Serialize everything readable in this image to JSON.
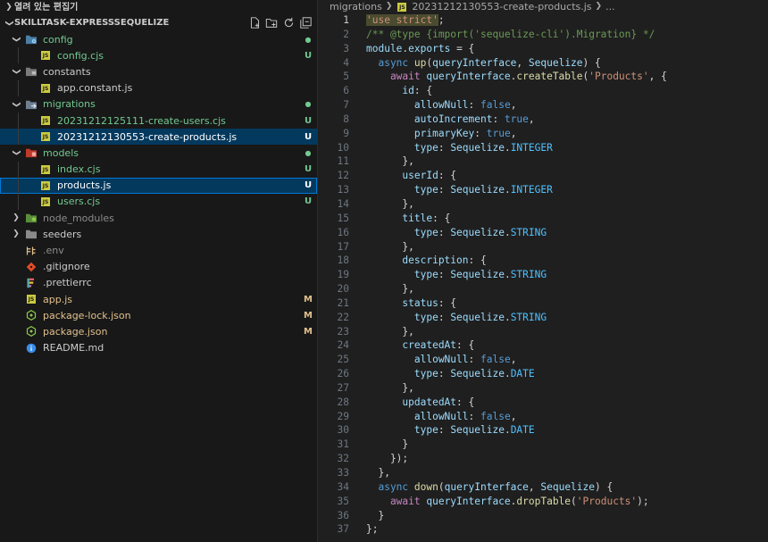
{
  "sidebar": {
    "open_editors": "열려 있는 편집기",
    "root": "SKILLTASK-EXPRESSSEQUELIZE",
    "items": [
      {
        "label": "config",
        "type": "folder",
        "depth": 0,
        "icon": "config-folder-icon",
        "open": true,
        "badge": "●",
        "badge_class": "dot",
        "color": "#73c991"
      },
      {
        "label": "config.cjs",
        "type": "file",
        "depth": 1,
        "icon": "js-file-icon",
        "badge": "U",
        "badge_class": "U",
        "color": "#73c991"
      },
      {
        "label": "constants",
        "type": "folder",
        "depth": 0,
        "icon": "constants-folder-icon",
        "open": true,
        "badge": "",
        "badge_class": "",
        "color": "#cccccc"
      },
      {
        "label": "app.constant.js",
        "type": "file",
        "depth": 1,
        "icon": "js-file-icon",
        "badge": "",
        "badge_class": "",
        "color": "#cccccc"
      },
      {
        "label": "migrations",
        "type": "folder",
        "depth": 0,
        "icon": "migrations-folder-icon",
        "open": true,
        "badge": "●",
        "badge_class": "dot",
        "color": "#73c991"
      },
      {
        "label": "20231212125111-create-users.cjs",
        "type": "file",
        "depth": 1,
        "icon": "js-file-icon",
        "badge": "U",
        "badge_class": "U",
        "color": "#73c991"
      },
      {
        "label": "20231212130553-create-products.js",
        "type": "file",
        "depth": 1,
        "icon": "js-file-icon",
        "badge": "U",
        "badge_class": "U",
        "color": "#ffffff",
        "selected": true
      },
      {
        "label": "models",
        "type": "folder",
        "depth": 0,
        "icon": "models-folder-icon",
        "open": true,
        "badge": "●",
        "badge_class": "dot",
        "color": "#73c991"
      },
      {
        "label": "index.cjs",
        "type": "file",
        "depth": 1,
        "icon": "js-file-icon",
        "badge": "U",
        "badge_class": "U",
        "color": "#73c991"
      },
      {
        "label": "products.js",
        "type": "file",
        "depth": 1,
        "icon": "js-file-icon",
        "badge": "U",
        "badge_class": "U",
        "color": "#ffffff",
        "focused": true
      },
      {
        "label": "users.cjs",
        "type": "file",
        "depth": 1,
        "icon": "js-file-icon",
        "badge": "U",
        "badge_class": "U",
        "color": "#73c991"
      },
      {
        "label": "node_modules",
        "type": "folder",
        "depth": 0,
        "icon": "node-modules-folder-icon",
        "open": false,
        "badge": "",
        "badge_class": "",
        "color": "#8c8c8c"
      },
      {
        "label": "seeders",
        "type": "folder",
        "depth": 0,
        "icon": "folder-icon",
        "open": false,
        "badge": "",
        "badge_class": "",
        "color": "#cccccc"
      },
      {
        "label": ".env",
        "type": "file",
        "depth": 0,
        "icon": "env-file-icon",
        "badge": "",
        "badge_class": "",
        "color": "#8c8c8c"
      },
      {
        "label": ".gitignore",
        "type": "file",
        "depth": 0,
        "icon": "git-file-icon",
        "badge": "",
        "badge_class": "",
        "color": "#cccccc"
      },
      {
        "label": ".prettierrc",
        "type": "file",
        "depth": 0,
        "icon": "prettier-file-icon",
        "badge": "",
        "badge_class": "",
        "color": "#cccccc"
      },
      {
        "label": "app.js",
        "type": "file",
        "depth": 0,
        "icon": "js-file-icon",
        "badge": "M",
        "badge_class": "M",
        "color": "#e2c08d"
      },
      {
        "label": "package-lock.json",
        "type": "file",
        "depth": 0,
        "icon": "npm-json-icon",
        "badge": "M",
        "badge_class": "M",
        "color": "#e2c08d"
      },
      {
        "label": "package.json",
        "type": "file",
        "depth": 0,
        "icon": "npm-json-icon",
        "badge": "M",
        "badge_class": "M",
        "color": "#e2c08d"
      },
      {
        "label": "README.md",
        "type": "file",
        "depth": 0,
        "icon": "info-icon",
        "badge": "",
        "badge_class": "",
        "color": "#cccccc"
      }
    ]
  },
  "editor": {
    "breadcrumb": [
      "migrations",
      "20231212130553-create-products.js",
      "..."
    ],
    "current_line": 1,
    "lines": [
      [
        [
          "'use strict'",
          "#ce9178"
        ],
        [
          ";",
          "#d4d4d4"
        ]
      ],
      [
        [
          "/** @type {import('sequelize-cli').Migration} */",
          "#6a9955"
        ]
      ],
      [
        [
          "module",
          "#9cdcfe"
        ],
        [
          ".",
          "#d4d4d4"
        ],
        [
          "exports",
          "#9cdcfe"
        ],
        [
          " = {",
          "#d4d4d4"
        ]
      ],
      [
        [
          "  async ",
          "#569cd6"
        ],
        [
          "up",
          "#dcdcaa"
        ],
        [
          "(",
          "#d4d4d4"
        ],
        [
          "queryInterface",
          "#9cdcfe"
        ],
        [
          ", ",
          "#d4d4d4"
        ],
        [
          "Sequelize",
          "#9cdcfe"
        ],
        [
          ") {",
          "#d4d4d4"
        ]
      ],
      [
        [
          "    await ",
          "#c586c0"
        ],
        [
          "queryInterface",
          "#9cdcfe"
        ],
        [
          ".",
          "#d4d4d4"
        ],
        [
          "createTable",
          "#dcdcaa"
        ],
        [
          "(",
          "#d4d4d4"
        ],
        [
          "'Products'",
          "#ce9178"
        ],
        [
          ", {",
          "#d4d4d4"
        ]
      ],
      [
        [
          "      id",
          "#9cdcfe"
        ],
        [
          ": {",
          "#d4d4d4"
        ]
      ],
      [
        [
          "        allowNull",
          "#9cdcfe"
        ],
        [
          ": ",
          "#d4d4d4"
        ],
        [
          "false",
          "#569cd6"
        ],
        [
          ",",
          "#d4d4d4"
        ]
      ],
      [
        [
          "        autoIncrement",
          "#9cdcfe"
        ],
        [
          ": ",
          "#d4d4d4"
        ],
        [
          "true",
          "#569cd6"
        ],
        [
          ",",
          "#d4d4d4"
        ]
      ],
      [
        [
          "        primaryKey",
          "#9cdcfe"
        ],
        [
          ": ",
          "#d4d4d4"
        ],
        [
          "true",
          "#569cd6"
        ],
        [
          ",",
          "#d4d4d4"
        ]
      ],
      [
        [
          "        type",
          "#9cdcfe"
        ],
        [
          ": ",
          "#d4d4d4"
        ],
        [
          "Sequelize",
          "#9cdcfe"
        ],
        [
          ".",
          "#d4d4d4"
        ],
        [
          "INTEGER",
          "#4fc1ff"
        ]
      ],
      [
        [
          "      },",
          "#d4d4d4"
        ]
      ],
      [
        [
          "      userId",
          "#9cdcfe"
        ],
        [
          ": {",
          "#d4d4d4"
        ]
      ],
      [
        [
          "        type",
          "#9cdcfe"
        ],
        [
          ": ",
          "#d4d4d4"
        ],
        [
          "Sequelize",
          "#9cdcfe"
        ],
        [
          ".",
          "#d4d4d4"
        ],
        [
          "INTEGER",
          "#4fc1ff"
        ]
      ],
      [
        [
          "      },",
          "#d4d4d4"
        ]
      ],
      [
        [
          "      title",
          "#9cdcfe"
        ],
        [
          ": {",
          "#d4d4d4"
        ]
      ],
      [
        [
          "        type",
          "#9cdcfe"
        ],
        [
          ": ",
          "#d4d4d4"
        ],
        [
          "Sequelize",
          "#9cdcfe"
        ],
        [
          ".",
          "#d4d4d4"
        ],
        [
          "STRING",
          "#4fc1ff"
        ]
      ],
      [
        [
          "      },",
          "#d4d4d4"
        ]
      ],
      [
        [
          "      description",
          "#9cdcfe"
        ],
        [
          ": {",
          "#d4d4d4"
        ]
      ],
      [
        [
          "        type",
          "#9cdcfe"
        ],
        [
          ": ",
          "#d4d4d4"
        ],
        [
          "Sequelize",
          "#9cdcfe"
        ],
        [
          ".",
          "#d4d4d4"
        ],
        [
          "STRING",
          "#4fc1ff"
        ]
      ],
      [
        [
          "      },",
          "#d4d4d4"
        ]
      ],
      [
        [
          "      status",
          "#9cdcfe"
        ],
        [
          ": {",
          "#d4d4d4"
        ]
      ],
      [
        [
          "        type",
          "#9cdcfe"
        ],
        [
          ": ",
          "#d4d4d4"
        ],
        [
          "Sequelize",
          "#9cdcfe"
        ],
        [
          ".",
          "#d4d4d4"
        ],
        [
          "STRING",
          "#4fc1ff"
        ]
      ],
      [
        [
          "      },",
          "#d4d4d4"
        ]
      ],
      [
        [
          "      createdAt",
          "#9cdcfe"
        ],
        [
          ": {",
          "#d4d4d4"
        ]
      ],
      [
        [
          "        allowNull",
          "#9cdcfe"
        ],
        [
          ": ",
          "#d4d4d4"
        ],
        [
          "false",
          "#569cd6"
        ],
        [
          ",",
          "#d4d4d4"
        ]
      ],
      [
        [
          "        type",
          "#9cdcfe"
        ],
        [
          ": ",
          "#d4d4d4"
        ],
        [
          "Sequelize",
          "#9cdcfe"
        ],
        [
          ".",
          "#d4d4d4"
        ],
        [
          "DATE",
          "#4fc1ff"
        ]
      ],
      [
        [
          "      },",
          "#d4d4d4"
        ]
      ],
      [
        [
          "      updatedAt",
          "#9cdcfe"
        ],
        [
          ": {",
          "#d4d4d4"
        ]
      ],
      [
        [
          "        allowNull",
          "#9cdcfe"
        ],
        [
          ": ",
          "#d4d4d4"
        ],
        [
          "false",
          "#569cd6"
        ],
        [
          ",",
          "#d4d4d4"
        ]
      ],
      [
        [
          "        type",
          "#9cdcfe"
        ],
        [
          ": ",
          "#d4d4d4"
        ],
        [
          "Sequelize",
          "#9cdcfe"
        ],
        [
          ".",
          "#d4d4d4"
        ],
        [
          "DATE",
          "#4fc1ff"
        ]
      ],
      [
        [
          "      }",
          "#d4d4d4"
        ]
      ],
      [
        [
          "    });",
          "#d4d4d4"
        ]
      ],
      [
        [
          "  },",
          "#d4d4d4"
        ]
      ],
      [
        [
          "  async ",
          "#569cd6"
        ],
        [
          "down",
          "#dcdcaa"
        ],
        [
          "(",
          "#d4d4d4"
        ],
        [
          "queryInterface",
          "#9cdcfe"
        ],
        [
          ", ",
          "#d4d4d4"
        ],
        [
          "Sequelize",
          "#9cdcfe"
        ],
        [
          ") {",
          "#d4d4d4"
        ]
      ],
      [
        [
          "    await ",
          "#c586c0"
        ],
        [
          "queryInterface",
          "#9cdcfe"
        ],
        [
          ".",
          "#d4d4d4"
        ],
        [
          "dropTable",
          "#dcdcaa"
        ],
        [
          "(",
          "#d4d4d4"
        ],
        [
          "'Products'",
          "#ce9178"
        ],
        [
          ");",
          "#d4d4d4"
        ]
      ],
      [
        [
          "  }",
          "#d4d4d4"
        ]
      ],
      [
        [
          "};",
          "#d4d4d4"
        ]
      ]
    ]
  }
}
